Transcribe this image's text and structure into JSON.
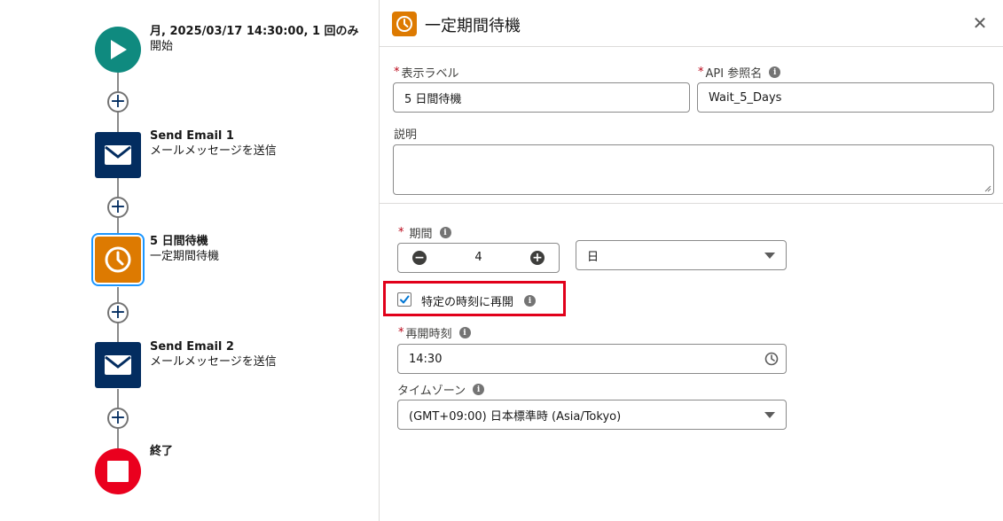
{
  "flow": {
    "start": {
      "title": "月, 2025/03/17 14:30:00, 1 回のみ",
      "subtitle": "開始"
    },
    "email1": {
      "title": "Send Email 1",
      "subtitle": "メールメッセージを送信"
    },
    "wait": {
      "title": "5 日間待機",
      "subtitle": "一定期間待機"
    },
    "email2": {
      "title": "Send Email 2",
      "subtitle": "メールメッセージを送信"
    },
    "end": {
      "title": "終了"
    },
    "add_symbol": "+"
  },
  "panel": {
    "title": "一定期間待機",
    "close_symbol": "✕",
    "label_field": {
      "required": "*",
      "label": "表示ラベル",
      "value": "5 日間待機"
    },
    "api_field": {
      "required": "*",
      "label": "API 参照名",
      "value": "Wait_5_Days"
    },
    "description": {
      "label": "説明",
      "value": ""
    },
    "duration": {
      "required": "*",
      "label": "期間",
      "value": "4",
      "minus": "−",
      "plus": "+"
    },
    "unit": {
      "selected": "日"
    },
    "specific_time": {
      "label": "特定の時刻に再開",
      "checked": true
    },
    "resume_time": {
      "required": "*",
      "label": "再開時刻",
      "value": "14:30"
    },
    "timezone": {
      "label": "タイムゾーン",
      "selected": "(GMT+09:00) 日本標準時 (Asia/Tokyo)"
    },
    "info_symbol": "i"
  },
  "colors": {
    "start": "#0f8a7f",
    "email": "#032d60",
    "wait": "#dd7a01",
    "end": "#ea001e",
    "highlight": "#e1001a",
    "focus_ring": "#1b96ff",
    "checkbox_check": "#0176d3"
  },
  "icons": {
    "start": "play-icon",
    "email": "envelope-icon",
    "wait": "clock-icon",
    "end": "stop-icon",
    "add": "plus-icon",
    "close": "close-icon",
    "info": "info-icon",
    "dropdown": "chevron-down-icon"
  }
}
